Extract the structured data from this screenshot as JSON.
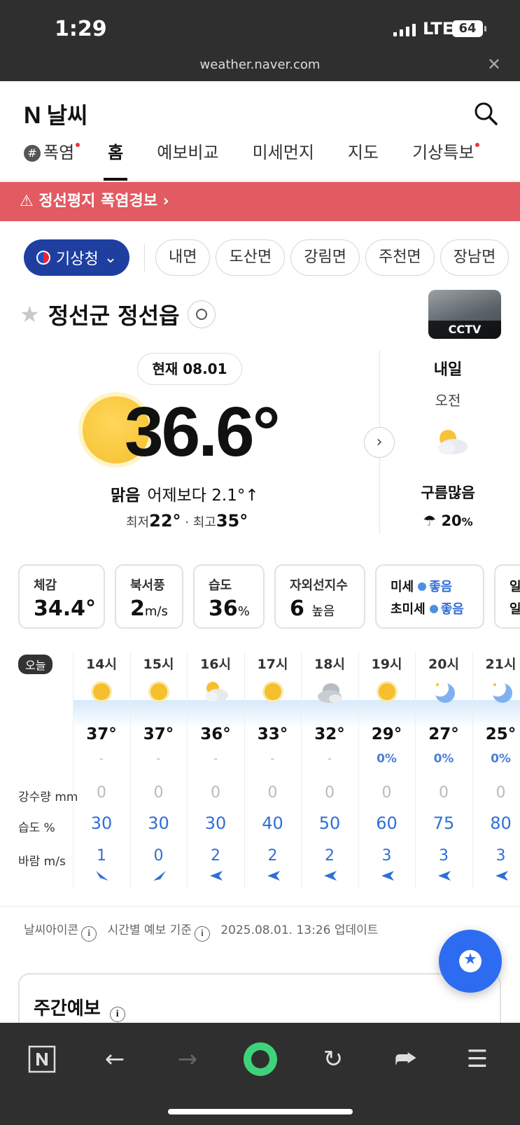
{
  "status": {
    "time": "1:29",
    "network": "LTE",
    "battery": "64"
  },
  "browser": {
    "url": "weather.naver.com"
  },
  "header": {
    "logo_n": "N",
    "title": "날씨"
  },
  "tabs": [
    {
      "label": "폭염",
      "hash": "#",
      "dot": true
    },
    {
      "label": "홈",
      "active": true
    },
    {
      "label": "예보비교"
    },
    {
      "label": "미세먼지"
    },
    {
      "label": "지도"
    },
    {
      "label": "기상특보",
      "dot": true
    }
  ],
  "alert": {
    "text": "정선평지 폭염경보"
  },
  "source": {
    "label": "기상청"
  },
  "regions": [
    "내면",
    "도산면",
    "강림면",
    "주천면",
    "장남면"
  ],
  "location": {
    "name": "정선군 정선읍",
    "cctv_label": "CCTV"
  },
  "current": {
    "pill": "현재 08.01",
    "temp": "36.6°",
    "condition": "맑음",
    "compare": "어제보다 2.1°↑",
    "min_label": "최저",
    "min": "22°",
    "max_label": "최고",
    "max": "35°"
  },
  "tomorrow": {
    "title": "내일",
    "period": "오전",
    "condition": "구름많음",
    "rain": "20",
    "rain_unit": "%"
  },
  "cards": {
    "feels": {
      "label": "체감",
      "value": "34.4°"
    },
    "wind": {
      "label": "북서풍",
      "value": "2",
      "unit": "m/s"
    },
    "humidity": {
      "label": "습도",
      "value": "36",
      "unit": "%"
    },
    "uv": {
      "label": "자외선지수",
      "value": "6",
      "unit": "높음"
    },
    "dust": {
      "pm10_label": "미세",
      "pm10": "좋음",
      "pm25_label": "초미세",
      "pm25": "좋음"
    },
    "extra": {
      "line1": "일",
      "line2": "일"
    }
  },
  "hourly": {
    "today_label": "오늘",
    "rain_label": "강수량 mm",
    "humidity_label": "습도 %",
    "wind_label": "바람 m/s",
    "hours": [
      {
        "h": "14시",
        "icon": "sun-icon",
        "t": "37°",
        "p": "-",
        "r": "0",
        "hu": "30",
        "w": "1"
      },
      {
        "h": "15시",
        "icon": "sun-icon",
        "t": "37°",
        "p": "-",
        "r": "0",
        "hu": "30",
        "w": "0"
      },
      {
        "h": "16시",
        "icon": "partly-cloudy-icon",
        "t": "36°",
        "p": "-",
        "r": "0",
        "hu": "30",
        "w": "2"
      },
      {
        "h": "17시",
        "icon": "sun-icon",
        "t": "33°",
        "p": "-",
        "r": "0",
        "hu": "40",
        "w": "2"
      },
      {
        "h": "18시",
        "icon": "cloud-icon",
        "t": "32°",
        "p": "-",
        "r": "0",
        "hu": "50",
        "w": "2"
      },
      {
        "h": "19시",
        "icon": "sun-icon",
        "t": "29°",
        "p": "0%",
        "r": "0",
        "hu": "60",
        "w": "3"
      },
      {
        "h": "20시",
        "icon": "moon-icon",
        "t": "27°",
        "p": "0%",
        "r": "0",
        "hu": "75",
        "w": "3"
      },
      {
        "h": "21시",
        "icon": "moon-icon",
        "t": "25°",
        "p": "0%",
        "r": "0",
        "hu": "80",
        "w": "3"
      }
    ]
  },
  "meta": {
    "icon_label": "날씨아이콘",
    "basis_label": "시간별 예보 기준",
    "updated": "2025.08.01. 13:26 업데이트"
  },
  "weekly": {
    "title": "주간예보"
  },
  "colors": {
    "accent": "#2d6cf0",
    "alert": "#e25a62",
    "kma": "#1e3fa0"
  }
}
